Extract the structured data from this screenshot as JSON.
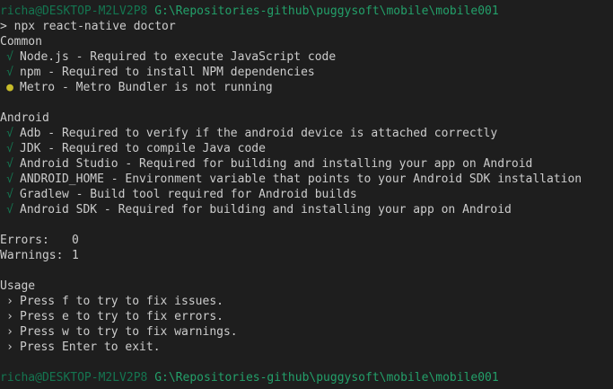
{
  "prompt": {
    "user_host": "richa@DESKTOP-M2LV2P8",
    "path": "G:\\Repositories-github\\puggysoft\\mobile\\mobile001"
  },
  "command": {
    "symbol": ">",
    "text": "npx react-native doctor"
  },
  "common": {
    "heading": "Common",
    "items": [
      {
        "status": "ok",
        "glyph": "√",
        "text": "Node.js - Required to execute JavaScript code"
      },
      {
        "status": "ok",
        "glyph": "√",
        "text": "npm - Required to install NPM dependencies"
      },
      {
        "status": "warning",
        "glyph": "●",
        "text": "Metro - Metro Bundler is not running"
      }
    ]
  },
  "android": {
    "heading": "Android",
    "items": [
      {
        "status": "ok",
        "glyph": "√",
        "text": "Adb - Required to verify if the android device is attached correctly"
      },
      {
        "status": "ok",
        "glyph": "√",
        "text": "JDK - Required to compile Java code"
      },
      {
        "status": "ok",
        "glyph": "√",
        "text": "Android Studio - Required for building and installing your app on Android"
      },
      {
        "status": "ok",
        "glyph": "√",
        "text": "ANDROID_HOME - Environment variable that points to your Android SDK installation"
      },
      {
        "status": "ok",
        "glyph": "√",
        "text": "Gradlew - Build tool required for Android builds"
      },
      {
        "status": "ok",
        "glyph": "√",
        "text": "Android SDK - Required for building and installing your app on Android"
      }
    ]
  },
  "summary": {
    "errors_label": "Errors:",
    "errors_value": "0",
    "warnings_label": "Warnings:",
    "warnings_value": "1"
  },
  "usage": {
    "heading": "Usage",
    "glyph": "›",
    "items": [
      "Press f to try to fix issues.",
      "Press e to try to fix errors.",
      "Press w to try to fix warnings.",
      "Press Enter to exit."
    ]
  },
  "prompt_end": {
    "user_host": "richa@DESKTOP-M2LV2P8",
    "path": "G:\\Repositories-github\\puggysoft\\mobile\\mobile001"
  },
  "colors": {
    "background": "#1e1e1e",
    "text": "#cccccc",
    "ok": "#0dbc79",
    "warning": "#c7bc2a",
    "path": "#23a06a"
  }
}
